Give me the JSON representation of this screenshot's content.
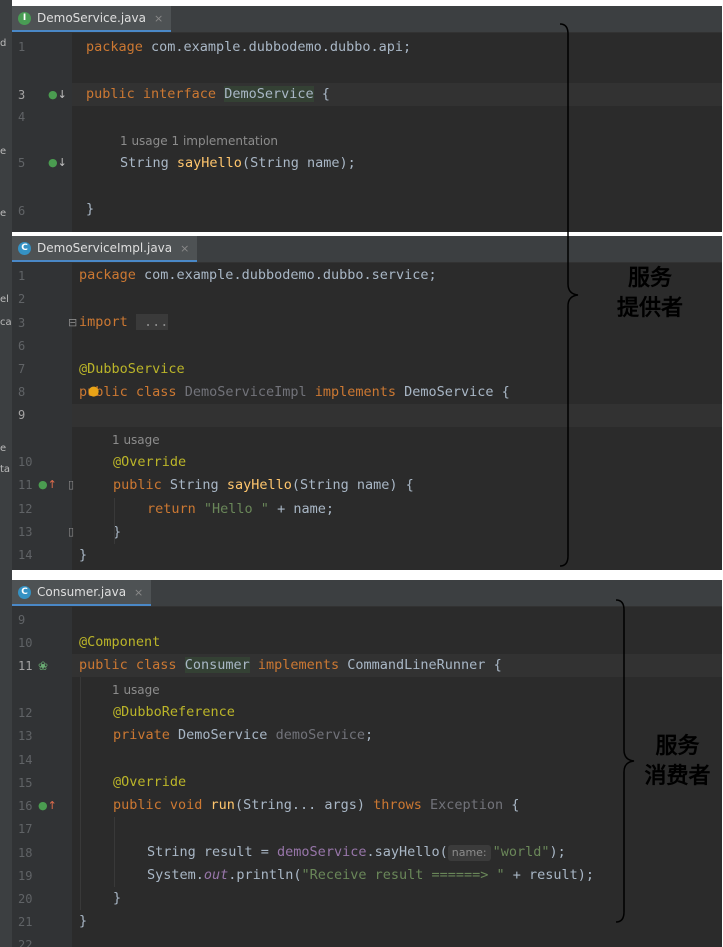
{
  "panels": {
    "p1": {
      "tab": {
        "icon_letter": "I",
        "icon_color": "#499c54",
        "name": "DemoService.java",
        "close": "×"
      },
      "line_numbers": [
        "1",
        "",
        "3",
        "4",
        "",
        "5",
        "",
        "6"
      ],
      "hint_usage": "1 usage",
      "hint_impl": "1 implementation",
      "l1": {
        "kw": "package",
        "rest": " com.example.dubbodemo.dubbo.api;"
      },
      "l3": {
        "kw1": "public",
        "kw2": " interface",
        "name": "DemoService",
        "rest": " {"
      },
      "l5": {
        "t1": "String ",
        "fn": "sayHello",
        "t2": "(String name);"
      },
      "l6": {
        "t": "}"
      }
    },
    "p2": {
      "tab": {
        "icon_letter": "C",
        "icon_color": "#3592c4",
        "name": "DemoServiceImpl.java",
        "close": "×"
      },
      "line_numbers": [
        "1",
        "2",
        "3",
        "6",
        "7",
        "8",
        "9",
        "10",
        "11",
        "12",
        "13",
        "14"
      ],
      "hint_usage": "1 usage",
      "l1": {
        "kw": "package",
        "rest": " com.example.dubbodemo.dubbo.service;"
      },
      "l3": {
        "kw": "import",
        "fold": " ..."
      },
      "l7": {
        "ann": "@DubboService"
      },
      "l8": {
        "kw1": "public",
        "kw2": " class",
        "unused": " DemoServiceImpl",
        "kw3": " implements",
        "rest": " DemoService {"
      },
      "l10": {
        "ann": "@Override"
      },
      "l11": {
        "kw": "public",
        "t1": " String ",
        "fn": "sayHello",
        "t2": "(String name) {"
      },
      "l12": {
        "kw": "return",
        "str": " \"Hello \"",
        "rest": " + name;"
      },
      "l13": {
        "t": "}"
      },
      "l14": {
        "t": "}"
      }
    },
    "p3": {
      "tab": {
        "icon_letter": "C",
        "icon_color": "#3592c4",
        "name": "Consumer.java",
        "close": "×"
      },
      "line_numbers": [
        "9",
        "10",
        "11",
        "12",
        "13",
        "14",
        "15",
        "16",
        "17",
        "18",
        "19",
        "20",
        "21",
        "22"
      ],
      "hint_usage": "1 usage",
      "l10": {
        "ann": "@Component"
      },
      "l11": {
        "kw1": "public",
        "kw2": " class",
        "name": "Consumer",
        "kw3": " implements",
        "rest": " CommandLineRunner {"
      },
      "l12": {
        "ann": "@DubboReference"
      },
      "l13": {
        "kw": "private",
        "t1": " DemoService ",
        "unused": "demoService",
        "rest": ";"
      },
      "l15": {
        "ann": "@Override"
      },
      "l16": {
        "kw1": "public",
        "kw2": " void",
        "fn": " run",
        "t1": "(String... args) ",
        "kw3": "throws",
        "unused": " Exception",
        "rest": " {"
      },
      "l18": {
        "t1": "String result = ",
        "field": "demoService",
        "t2": ".sayHello(",
        "hint": "name:",
        "str": "\"world\"",
        "t3": ");"
      },
      "l19": {
        "t1": "System.",
        "field": "out",
        "t2": ".println(",
        "str": "\"Receive result ======> \"",
        "t3": " + result);"
      },
      "l20": {
        "t": "}"
      },
      "l21": {
        "t": "}"
      }
    }
  },
  "left_strip_chars": [
    "d",
    "e",
    "e",
    "el",
    "ca",
    "e",
    "ta"
  ],
  "callouts": {
    "provider_line1": "服务",
    "provider_line2": "提供者",
    "consumer_line1": "服务",
    "consumer_line2": "消费者"
  }
}
